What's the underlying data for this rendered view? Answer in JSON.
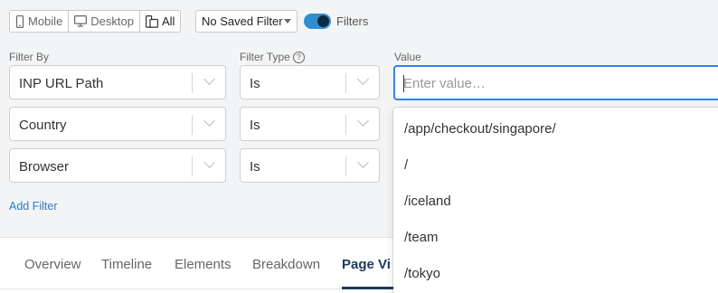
{
  "toolbar": {
    "devices": [
      {
        "label": "Mobile",
        "icon": "mobile-icon"
      },
      {
        "label": "Desktop",
        "icon": "desktop-icon"
      },
      {
        "label": "All",
        "icon": "all-devices-icon"
      }
    ],
    "saved_filter": "No Saved Filter",
    "filters_toggle_label": "Filters",
    "filters_toggle_on": true
  },
  "filters": {
    "headers": {
      "filter_by": "Filter By",
      "filter_type": "Filter Type",
      "value": "Value"
    },
    "rows": [
      {
        "filter_by": "INP URL Path",
        "filter_type": "Is"
      },
      {
        "filter_by": "Country",
        "filter_type": "Is"
      },
      {
        "filter_by": "Browser",
        "filter_type": "Is"
      }
    ],
    "value_placeholder": "Enter value…",
    "add_filter": "Add Filter"
  },
  "dropdown": {
    "options": [
      "/app/checkout/singapore/",
      "/",
      "/iceland",
      "/team",
      "/tokyo"
    ]
  },
  "tabs": [
    {
      "label": "Overview"
    },
    {
      "label": "Timeline"
    },
    {
      "label": "Elements"
    },
    {
      "label": "Breakdown"
    },
    {
      "label": "Page Vi"
    }
  ],
  "colors": {
    "accent": "#2684ff",
    "toggle": "#2f8ecf",
    "tab_active": "#1a3a5c",
    "link": "#2f7bbf"
  }
}
